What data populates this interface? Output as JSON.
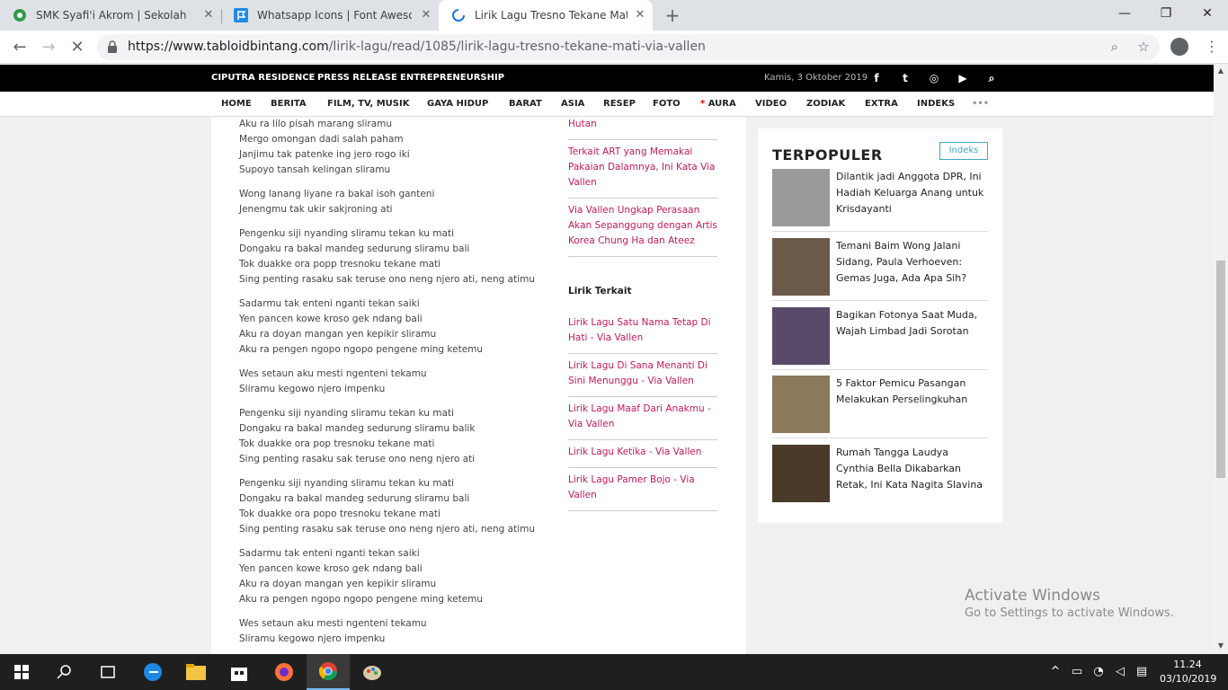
{
  "browser": {
    "tabs": [
      {
        "title": "SMK Syafi'i Akrom | Sekolah Menengah",
        "icon": "shield-green-icon"
      },
      {
        "title": "Whatsapp Icons | Font Awesome",
        "icon": "flag-blue-icon"
      },
      {
        "title": "Lirik Lagu Tresno Tekane Mati - Via Vallen",
        "icon": "loading-spinner-icon"
      }
    ],
    "url_host": "https://www.tabloidbintang.com",
    "url_path": "/lirik-lagu/read/1085/lirik-lagu-tresno-tekane-mati-via-vallen"
  },
  "site": {
    "top_links": [
      "CIPUTRA RESIDENCE",
      "PRESS RELEASE",
      "ENTREPRENEURSHIP"
    ],
    "date": "Kamis, 3 Oktober 2019",
    "social_icons": [
      "facebook-icon",
      "twitter-icon",
      "instagram-icon",
      "youtube-icon",
      "search-icon"
    ],
    "nav": [
      "HOME",
      "BERITA",
      "FILM, TV, MUSIK",
      "GAYA HIDUP",
      "BARAT",
      "ASIA",
      "RESEP",
      "FOTO",
      "AURA",
      "VIDEO",
      "ZODIAK",
      "EXTRA",
      "INDEKS"
    ],
    "nav_star": "*",
    "nav_more": "•••"
  },
  "lyrics": [
    [
      "Aku ra lilo pisah marang sliramu",
      "Mergo omongan dadi salah paham",
      "Janjimu tak patenke ing jero rogo iki",
      "Supoyo tansah kelingan sliramu"
    ],
    [
      "Wong lanang liyane ra bakal isoh ganteni",
      "Jenengmu tak ukir sakjroning ati"
    ],
    [
      "Pengenku siji nyanding sliramu tekan ku mati",
      "Dongaku ra bakal mandeg sedurung sliramu bali",
      "Tok duakke ora popp tresnoku tekane mati",
      "Sing penting rasaku sak teruse ono neng njero ati, neng atimu"
    ],
    [
      "Sadarmu tak enteni nganti tekan saiki",
      "Yen pancen kowe kroso gek ndang bali",
      "Aku ra doyan mangan yen kepikir sliramu",
      "Aku ra pengen ngopo ngopo pengene ming ketemu"
    ],
    [
      "Wes setaun aku mesti ngenteni tekamu",
      "Sliramu kegowo njero impenku"
    ],
    [
      "Pengenku siji nyanding sliramu tekan ku mati",
      "Dongaku ra bakal mandeg sedurung sliramu balik",
      "Tok duakke ora pop tresnoku tekane mati",
      "Sing penting rasaku sak teruse ono neng njero ati"
    ],
    [
      "Pengenku siji nyanding sliramu tekan ku mati",
      "Dongaku ra bakal mandeg sedurung sliramu bali",
      "Tok duakke ora popo tresnoku tekane mati",
      "Sing penting rasaku sak teruse ono neng njero ati, neng atimu"
    ],
    [
      "Sadarmu tak enteni nganti tekan saiki",
      "Yen pancen kowe kroso gek ndang bali",
      "Aku ra doyan mangan yen kepikir sliramu",
      "Aku ra pengen ngopo ngopo pengene ming ketemu"
    ],
    [
      "Wes setaun aku mesti ngenteni tekamu",
      "Sliramu kegowo njero impenku"
    ]
  ],
  "related_top": [
    "Hutan",
    "Terkait ART yang Memakai Pakaian Dalamnya, Ini Kata Via Vallen",
    "Via Vallen Ungkap Perasaan Akan Sepanggung dengan Artis Korea Chung Ha dan Ateez"
  ],
  "lirik_terkait_title": "Lirik Terkait",
  "lirik_terkait": [
    "Lirik Lagu Satu Nama Tetap Di Hati - Via Vallen",
    "Lirik Lagu Di Sana Menanti Di Sini Menunggu - Via Vallen",
    "Lirik Lagu Maaf Dari Anakmu - Via Vallen",
    "Lirik Lagu Ketika - Via Vallen",
    "Lirik Lagu Pamer Bojo - Via Vallen"
  ],
  "sidebar": {
    "title": "TERPOPULER",
    "indeks": "Indeks",
    "items": [
      {
        "title": "Dilantik jadi Anggota DPR, Ini Hadiah Keluarga Anang untuk Krisdayanti",
        "thumb_color": "#9a9a9a"
      },
      {
        "title": "Temani Baim Wong Jalani Sidang, Paula Verhoeven: Gemas Juga, Ada Apa Sih?",
        "thumb_color": "#6b5a4a"
      },
      {
        "title": "Bagikan Fotonya Saat Muda, Wajah Limbad Jadi Sorotan",
        "thumb_color": "#5a4a6a"
      },
      {
        "title": "5 Faktor Pemicu Pasangan Melakukan Perselingkuhan",
        "thumb_color": "#8a7a5a"
      },
      {
        "title": "Rumah Tangga Laudya Cynthia Bella Dikabarkan Retak, Ini Kata Nagita Slavina",
        "thumb_color": "#4a3a2a"
      }
    ]
  },
  "activate": {
    "line1": "Activate Windows",
    "line2": "Go to Settings to activate Windows."
  },
  "taskbar": {
    "apps": [
      "windows-start-icon",
      "search-icon",
      "task-view-icon",
      "edge-icon",
      "file-explorer-icon",
      "store-icon",
      "firefox-icon",
      "chrome-icon",
      "paint-icon"
    ],
    "time": "11.24",
    "date": "03/10/2019"
  }
}
